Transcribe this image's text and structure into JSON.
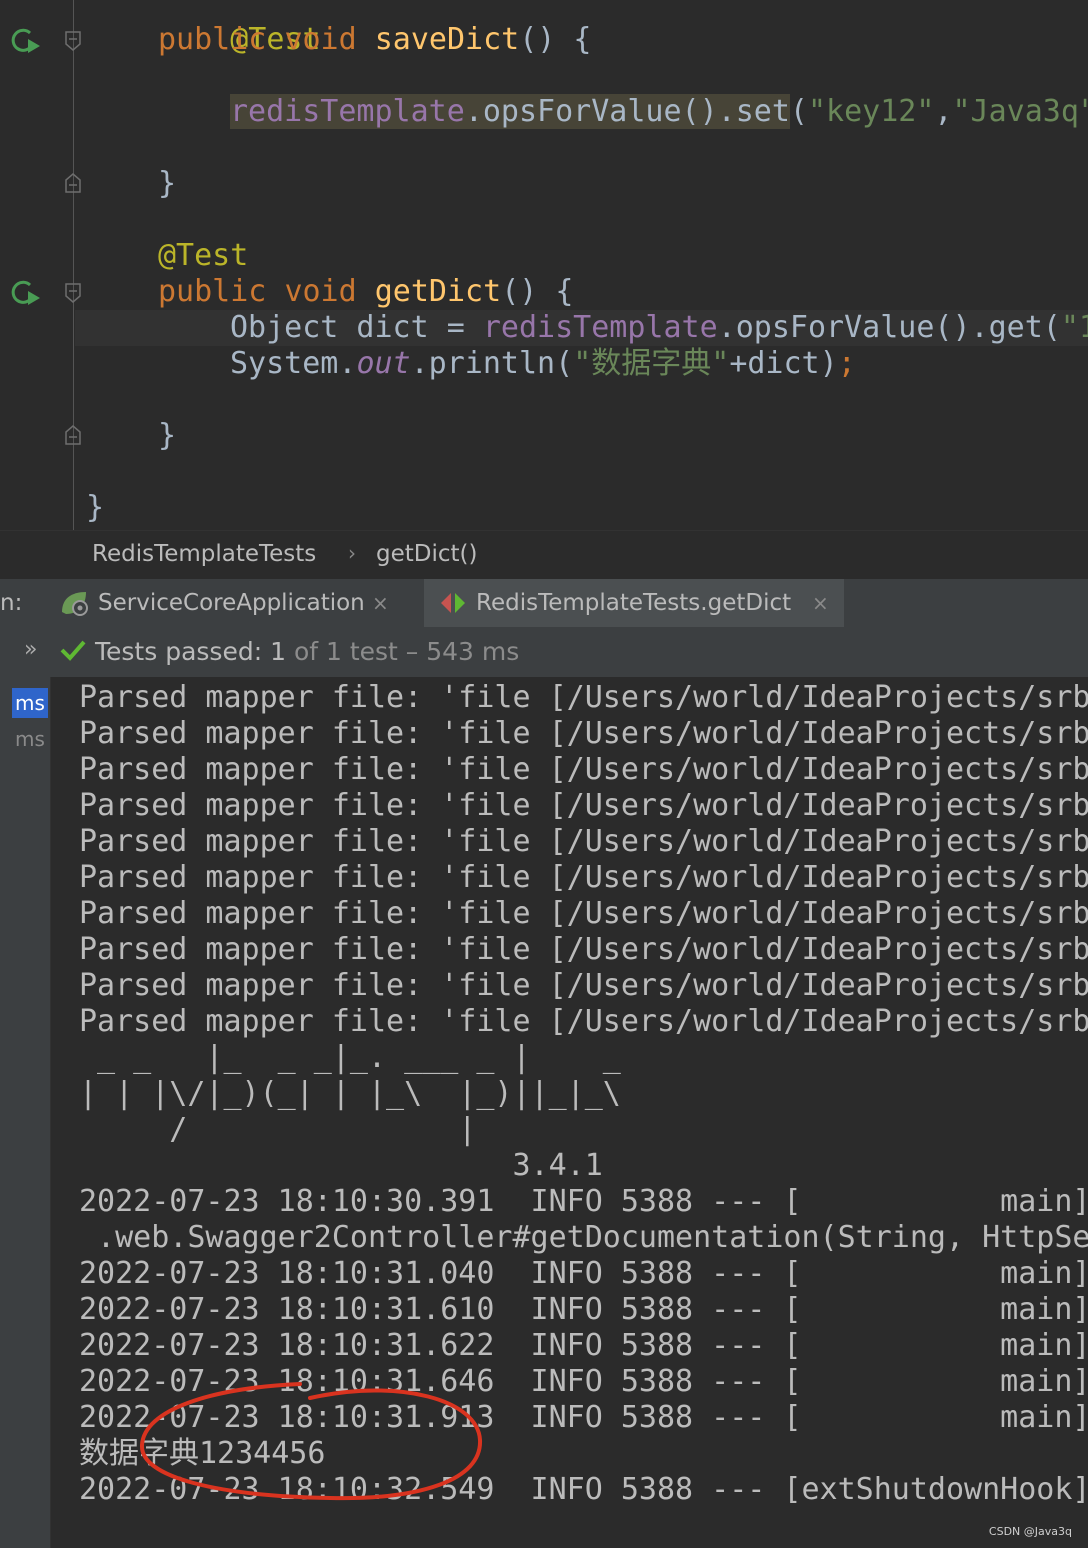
{
  "editor": {
    "lines": {
      "annotation_1": "@Test",
      "save_public": "public",
      "save_void": "void",
      "save_method": "saveDict",
      "save_rest": "() {",
      "save_field": "redisTemplate",
      "save_call": ".opsForValue().set",
      "save_paren": "(",
      "save_arg1": "\"key12\"",
      "save_comma": ",",
      "save_arg2": "\"Java3q\"",
      "save_close": "}",
      "annotation_2": "@Test",
      "get_public": "public",
      "get_void": "void",
      "get_method": "getDict",
      "get_rest": "() {",
      "get_decl": "Object dict = ",
      "get_field": "redisTemplate",
      "get_call": ".opsForValue().get(",
      "get_arg": "\"1",
      "print_system": "System.",
      "print_out": "out",
      "print_call": ".println(",
      "print_str": "\"数据字典\"",
      "print_concat": "+dict)",
      "print_semi": ";",
      "get_close": "}",
      "class_close": "}"
    }
  },
  "breadcrumb": {
    "class_name": "RedisTemplateTests",
    "separator": "›",
    "method_name": "getDict()"
  },
  "run_tabs": {
    "prefix": "n:",
    "tabs": [
      {
        "label": "ServiceCoreApplication",
        "close": "×",
        "icon": "spring-boot-icon"
      },
      {
        "label": "RedisTemplateTests.getDict",
        "close": "×",
        "icon": "junit-test-icon"
      }
    ]
  },
  "test_bar": {
    "expander": "»",
    "status_label": "Tests passed:",
    "count": "1",
    "of_text": "of 1 test",
    "duration": "– 543 ms"
  },
  "console_left": {
    "items": [
      "ms",
      "ms"
    ]
  },
  "console": {
    "lines": [
      "Parsed mapper file: 'file [/Users/world/IdeaProjects/srb",
      "Parsed mapper file: 'file [/Users/world/IdeaProjects/srb",
      "Parsed mapper file: 'file [/Users/world/IdeaProjects/srb",
      "Parsed mapper file: 'file [/Users/world/IdeaProjects/srb",
      "Parsed mapper file: 'file [/Users/world/IdeaProjects/srb",
      "Parsed mapper file: 'file [/Users/world/IdeaProjects/srb",
      "Parsed mapper file: 'file [/Users/world/IdeaProjects/srb",
      "Parsed mapper file: 'file [/Users/world/IdeaProjects/srb",
      "Parsed mapper file: 'file [/Users/world/IdeaProjects/srb",
      "Parsed mapper file: 'file [/Users/world/IdeaProjects/srb",
      " _ _   |_  _ _|_. ___ _ |    _",
      "| | |\\/|_)(_| | |_\\  |_)||_|_\\",
      "     /               |",
      "                        3.4.1",
      "2022-07-23 18:10:30.391  INFO 5388 --- [           main]",
      " .web.Swagger2Controller#getDocumentation(String, HttpSe",
      "2022-07-23 18:10:31.040  INFO 5388 --- [           main]",
      "2022-07-23 18:10:31.610  INFO 5388 --- [           main]",
      "2022-07-23 18:10:31.622  INFO 5388 --- [           main]",
      "2022-07-23 18:10:31.646  INFO 5388 --- [           main]",
      "2022-07-23 18:10:31.913  INFO 5388 --- [           main]",
      "数据字典1234456",
      "2022-07-23 18:10:32.549  INFO 5388 --- [extShutdownHook]"
    ]
  },
  "watermark": "CSDN @Java3q",
  "colors": {
    "editor_bg": "#2b2b2b",
    "keyword": "#cc7832",
    "annotation": "#bbb529",
    "method": "#ffc66d",
    "field": "#9876aa",
    "string": "#6a8759",
    "text": "#a9b7c6",
    "pass_green": "#5fb833",
    "annotation_circle": "#d9331f"
  }
}
